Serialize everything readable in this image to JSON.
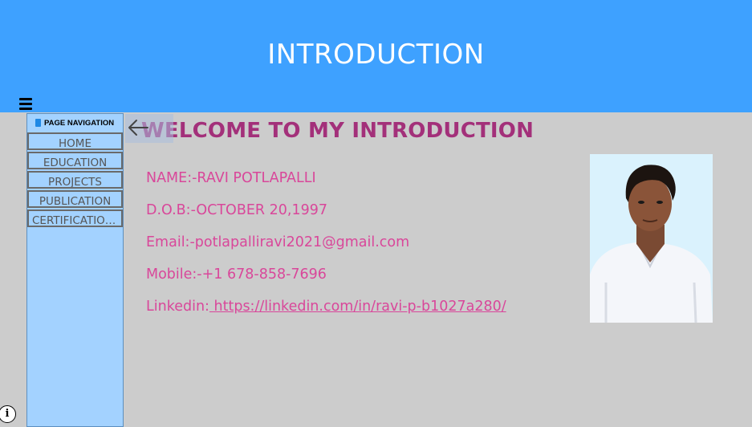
{
  "header": {
    "title": "INTRODUCTION"
  },
  "sidebar": {
    "heading": "PAGE NAVIGATION",
    "items": [
      {
        "label": "HOME"
      },
      {
        "label": "EDUCATION"
      },
      {
        "label": "PROJECTS"
      },
      {
        "label": "PUBLICATION"
      },
      {
        "label": "CERTIFICATIONS"
      }
    ]
  },
  "main": {
    "welcome": "WELCOME TO MY INTRODUCTION",
    "name": "NAME:-RAVI POTLAPALLI",
    "dob": "D.O.B:-OCTOBER 20,1997",
    "email": "Email:-potlapalliravi2021@gmail.com",
    "mobile": "Mobile:-+1 678-858-7696",
    "linkedin_label": "Linkedin:",
    "linkedin_url": " https://linkedin.com/in/ravi-p-b1027a280/"
  },
  "icons": {
    "menu": "hamburger-menu-icon",
    "back": "back-arrow-icon",
    "info": "info-icon",
    "book": "book-icon"
  },
  "colors": {
    "header_bg": "#3ea1ff",
    "sidebar_bg": "#a3d2ff",
    "page_bg": "#cccccc",
    "welcome_text": "#a3307a",
    "info_text": "#d9479a"
  }
}
